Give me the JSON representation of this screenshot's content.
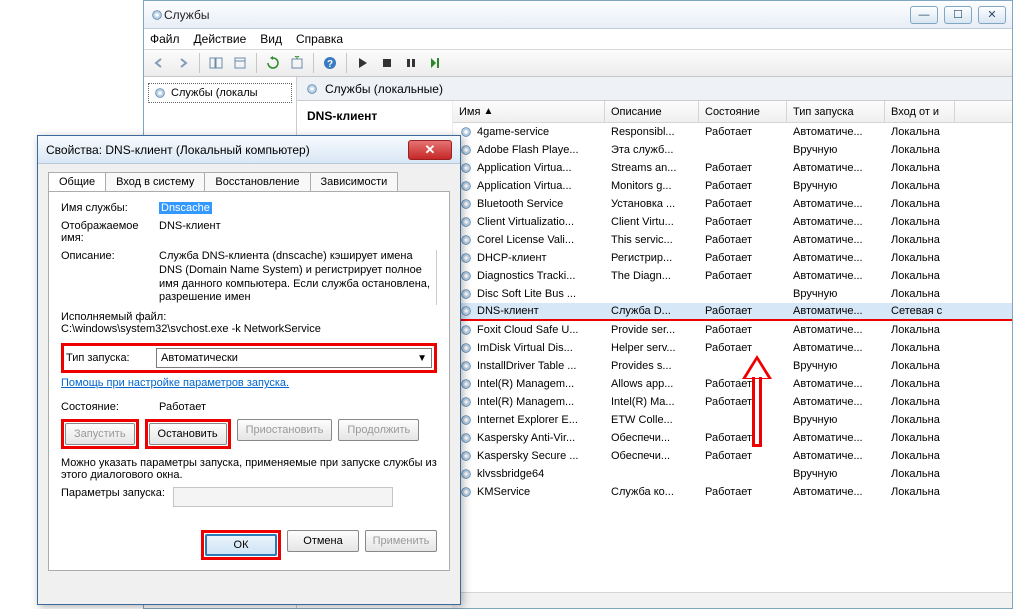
{
  "main_window": {
    "title": "Службы",
    "menu": {
      "file": "Файл",
      "action": "Действие",
      "view": "Вид",
      "help": "Справка"
    },
    "tree_item": "Службы (локалы",
    "pane_title": "Службы (локальные)",
    "desc_name": "DNS-клиент",
    "columns": {
      "name": "Имя",
      "desc": "Описание",
      "state": "Состояние",
      "start": "Тип запуска",
      "logon": "Вход от и"
    },
    "rows": [
      {
        "n": "4game-service",
        "d": "Responsibl...",
        "s": "Работает",
        "t": "Автоматиче...",
        "l": "Локальна"
      },
      {
        "n": "Adobe Flash Playe...",
        "d": "Эта служб...",
        "s": "",
        "t": "Вручную",
        "l": "Локальна"
      },
      {
        "n": "Application Virtua...",
        "d": "Streams an...",
        "s": "Работает",
        "t": "Автоматиче...",
        "l": "Локальна"
      },
      {
        "n": "Application Virtua...",
        "d": "Monitors g...",
        "s": "Работает",
        "t": "Вручную",
        "l": "Локальна"
      },
      {
        "n": "Bluetooth Service",
        "d": "Установка ...",
        "s": "Работает",
        "t": "Автоматиче...",
        "l": "Локальна"
      },
      {
        "n": "Client Virtualizatio...",
        "d": "Client Virtu...",
        "s": "Работает",
        "t": "Автоматиче...",
        "l": "Локальна"
      },
      {
        "n": "Corel License Vali...",
        "d": "This servic...",
        "s": "Работает",
        "t": "Автоматиче...",
        "l": "Локальна"
      },
      {
        "n": "DHCP-клиент",
        "d": "Регистрир...",
        "s": "Работает",
        "t": "Автоматиче...",
        "l": "Локальна"
      },
      {
        "n": "Diagnostics Tracki...",
        "d": "The Diagn...",
        "s": "Работает",
        "t": "Автоматиче...",
        "l": "Локальна"
      },
      {
        "n": "Disc Soft Lite Bus ...",
        "d": "",
        "s": "",
        "t": "Вручную",
        "l": "Локальна"
      },
      {
        "n": "DNS-клиент",
        "d": "Служба D...",
        "s": "Работает",
        "t": "Автоматиче...",
        "l": "Сетевая с",
        "dns": true
      },
      {
        "n": "Foxit Cloud Safe U...",
        "d": "Provide ser...",
        "s": "Работает",
        "t": "Автоматиче...",
        "l": "Локальна"
      },
      {
        "n": "ImDisk Virtual Dis...",
        "d": "Helper serv...",
        "s": "Работает",
        "t": "Автоматиче...",
        "l": "Локальна"
      },
      {
        "n": "InstallDriver Table ...",
        "d": "Provides s...",
        "s": "",
        "t": "Вручную",
        "l": "Локальна"
      },
      {
        "n": "Intel(R) Managem...",
        "d": "Allows app...",
        "s": "Работает",
        "t": "Автоматиче...",
        "l": "Локальна"
      },
      {
        "n": "Intel(R) Managem...",
        "d": "Intel(R) Ma...",
        "s": "Работает",
        "t": "Автоматиче...",
        "l": "Локальна"
      },
      {
        "n": "Internet Explorer E...",
        "d": "ETW Colle...",
        "s": "",
        "t": "Вручную",
        "l": "Локальна"
      },
      {
        "n": "Kaspersky Anti-Vir...",
        "d": "Обеспечи...",
        "s": "Работает",
        "t": "Автоматиче...",
        "l": "Локальна"
      },
      {
        "n": "Kaspersky Secure ...",
        "d": "Обеспечи...",
        "s": "Работает",
        "t": "Автоматиче...",
        "l": "Локальна"
      },
      {
        "n": "klvssbridge64",
        "d": "",
        "s": "",
        "t": "Вручную",
        "l": "Локальна"
      },
      {
        "n": "KMService",
        "d": "Служба ко...",
        "s": "Работает",
        "t": "Автоматиче...",
        "l": "Локальна"
      }
    ]
  },
  "dialog": {
    "title": "Свойства: DNS-клиент (Локальный компьютер)",
    "tabs": {
      "general": "Общие",
      "logon": "Вход в систему",
      "recovery": "Восстановление",
      "deps": "Зависимости"
    },
    "labels": {
      "name": "Имя службы:",
      "display": "Отображаемое имя:",
      "desc": "Описание:",
      "exec": "Исполняемый файл:",
      "start": "Тип запуска:",
      "state": "Состояние:",
      "params_hint": "Можно указать параметры запуска, применяемые при запуске службы из этого диалогового окна.",
      "params": "Параметры запуска:"
    },
    "values": {
      "name": "Dnscache",
      "display": "DNS-клиент",
      "desc": "Служба DNS-клиента (dnscache) кэширует имена DNS (Domain Name System) и регистрирует полное имя данного компьютера. Если служба остановлена, разрешение имен",
      "exec": "C:\\windows\\system32\\svchost.exe -k NetworkService",
      "start": "Автоматически",
      "state": "Работает",
      "help": "Помощь при настройке параметров запуска."
    },
    "buttons": {
      "start": "Запустить",
      "stop": "Остановить",
      "pause": "Приостановить",
      "resume": "Продолжить",
      "ok": "ОК",
      "cancel": "Отмена",
      "apply": "Применить"
    }
  }
}
